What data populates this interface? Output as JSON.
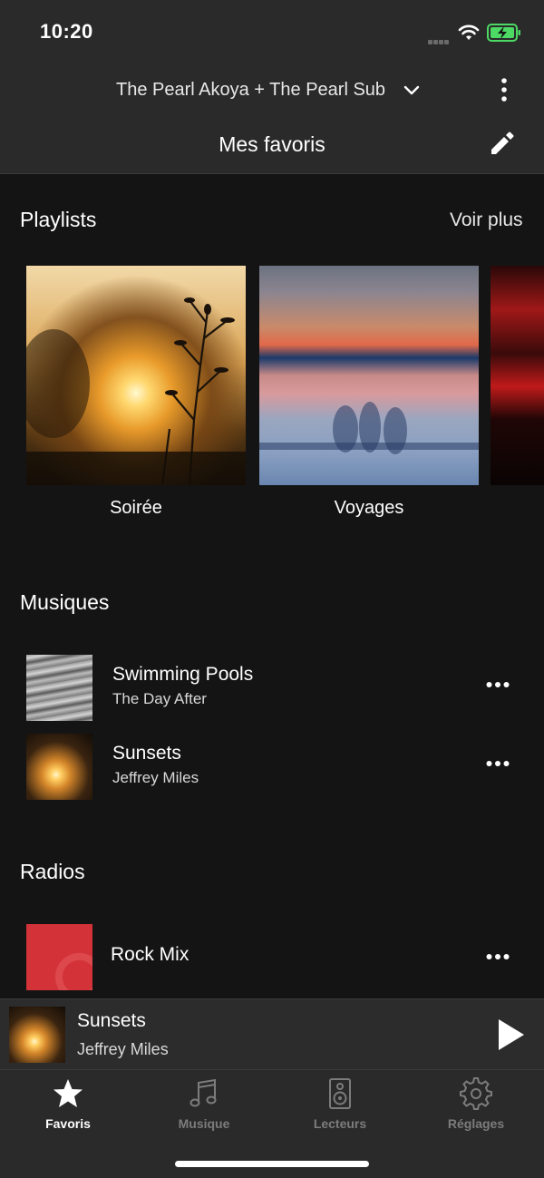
{
  "status_bar": {
    "time": "10:20",
    "icons": [
      "signal-icon",
      "wifi-icon",
      "battery-charging-icon"
    ]
  },
  "header": {
    "device": "The Pearl Akoya + The Pearl Sub",
    "title": "Mes favoris"
  },
  "playlists": {
    "title": "Playlists",
    "see_more": "Voir plus",
    "items": [
      {
        "label": "Soirée"
      },
      {
        "label": "Voyages"
      }
    ]
  },
  "music": {
    "title": "Musiques",
    "tracks": [
      {
        "title": "Swimming Pools",
        "artist": "The Day After"
      },
      {
        "title": "Sunsets",
        "artist": "Jeffrey Miles"
      }
    ]
  },
  "radios": {
    "title": "Radios",
    "items": [
      {
        "title": "Rock Mix"
      }
    ]
  },
  "now_playing": {
    "title": "Sunsets",
    "artist": "Jeffrey Miles"
  },
  "tabs": [
    {
      "label": "Favoris",
      "icon": "star-icon",
      "active": true
    },
    {
      "label": "Musique",
      "icon": "music-note-icon",
      "active": false
    },
    {
      "label": "Lecteurs",
      "icon": "speaker-icon",
      "active": false
    },
    {
      "label": "Réglages",
      "icon": "gear-icon",
      "active": false
    }
  ],
  "colors": {
    "background": "#141414",
    "bar": "#2a2a2a",
    "active_tab": "#ffffff",
    "inactive_tab": "#7c7c7c",
    "battery": "#4cd964"
  }
}
